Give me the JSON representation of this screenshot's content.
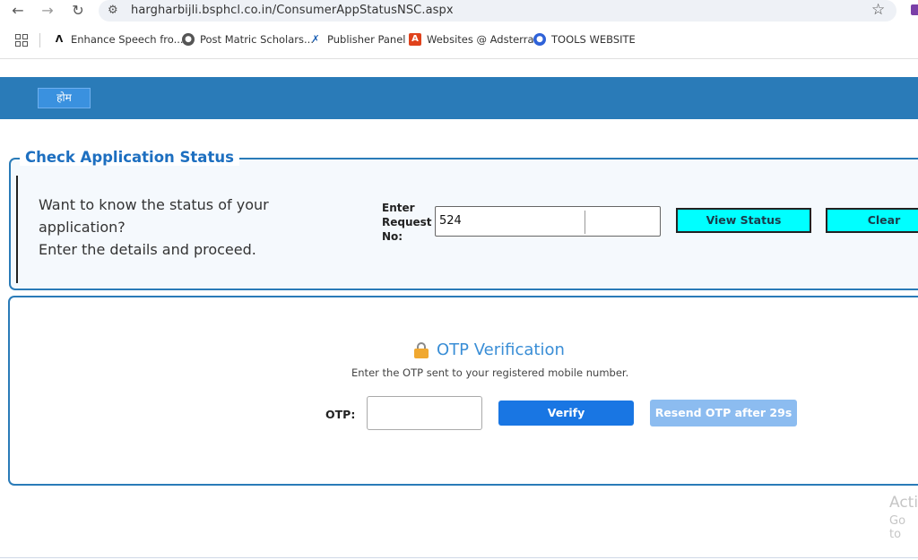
{
  "browser": {
    "url": "hargharbijli.bsphcl.co.in/ConsumerAppStatusNSC.aspx",
    "icons": {
      "back": "back-arrow-icon",
      "forward": "forward-arrow-icon",
      "reload": "reload-icon",
      "star": "star-icon"
    },
    "bookmarks": [
      {
        "label": "Enhance Speech fro...",
        "icon": "adobe-icon"
      },
      {
        "label": "Post Matric Scholars...",
        "icon": "globe-icon"
      },
      {
        "label": "Publisher Panel",
        "icon": "publisher-icon"
      },
      {
        "label": "Websites @ Adsterra",
        "icon": "adsterra-icon"
      },
      {
        "label": "TOOLS WEBSITE",
        "icon": "tools-icon"
      }
    ]
  },
  "header": {
    "home_label": "होम",
    "bar_color": "#2a7bb8"
  },
  "status": {
    "title": "Check Application Status",
    "intro_line1": "Want to know the status of your",
    "intro_line2": "application?",
    "intro_line3": "Enter the details and proceed.",
    "request_label_1": "Enter",
    "request_label_2": "Request",
    "request_label_3": "No:",
    "request_value": "524",
    "view_status_label": "View Status",
    "clear_label": "Clear",
    "button_color": "#00ffff"
  },
  "otp": {
    "title": "OTP Verification",
    "subtitle": "Enter the OTP sent to your registered mobile number.",
    "label": "OTP:",
    "value": "",
    "verify_label": "Verify",
    "resend_label": "Resend OTP after 29s",
    "accent": "#1976e3"
  },
  "watermark": {
    "line1": "Acti",
    "line2": "Go to"
  }
}
